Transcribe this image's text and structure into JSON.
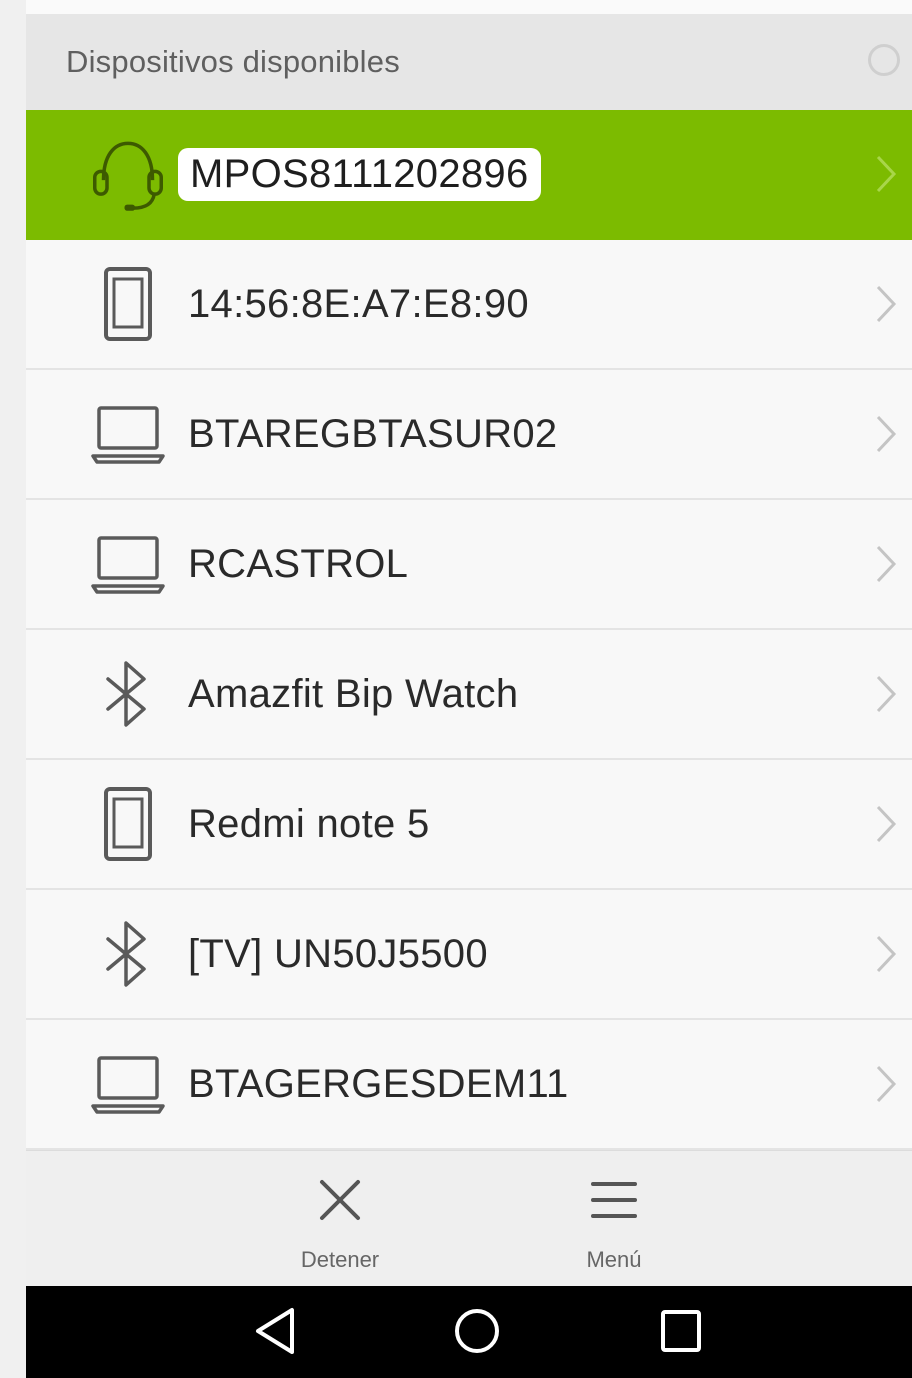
{
  "header": {
    "title": "Dispositivos disponibles",
    "refresh_icon": "loading-circle-icon"
  },
  "devices": [
    {
      "name": "MPOS8111202896",
      "icon": "headset-icon",
      "selected": true
    },
    {
      "name": "14:56:8E:A7:E8:90",
      "icon": "phone-icon",
      "selected": false
    },
    {
      "name": "BTAREGBTASUR02",
      "icon": "laptop-icon",
      "selected": false
    },
    {
      "name": "RCASTROL",
      "icon": "laptop-icon",
      "selected": false
    },
    {
      "name": "Amazfit Bip Watch",
      "icon": "bluetooth-icon",
      "selected": false
    },
    {
      "name": "Redmi note 5",
      "icon": "phone-icon",
      "selected": false
    },
    {
      "name": "[TV] UN50J5500",
      "icon": "bluetooth-icon",
      "selected": false
    },
    {
      "name": "BTAGERGESDEM11",
      "icon": "laptop-icon",
      "selected": false
    }
  ],
  "bottom_bar": {
    "stop_label": "Detener",
    "menu_label": "Menú"
  },
  "nav": [
    "back-icon",
    "home-icon",
    "recents-icon"
  ],
  "colors": {
    "accent": "#7cbb00",
    "icon_gray": "#5a5a5a"
  }
}
